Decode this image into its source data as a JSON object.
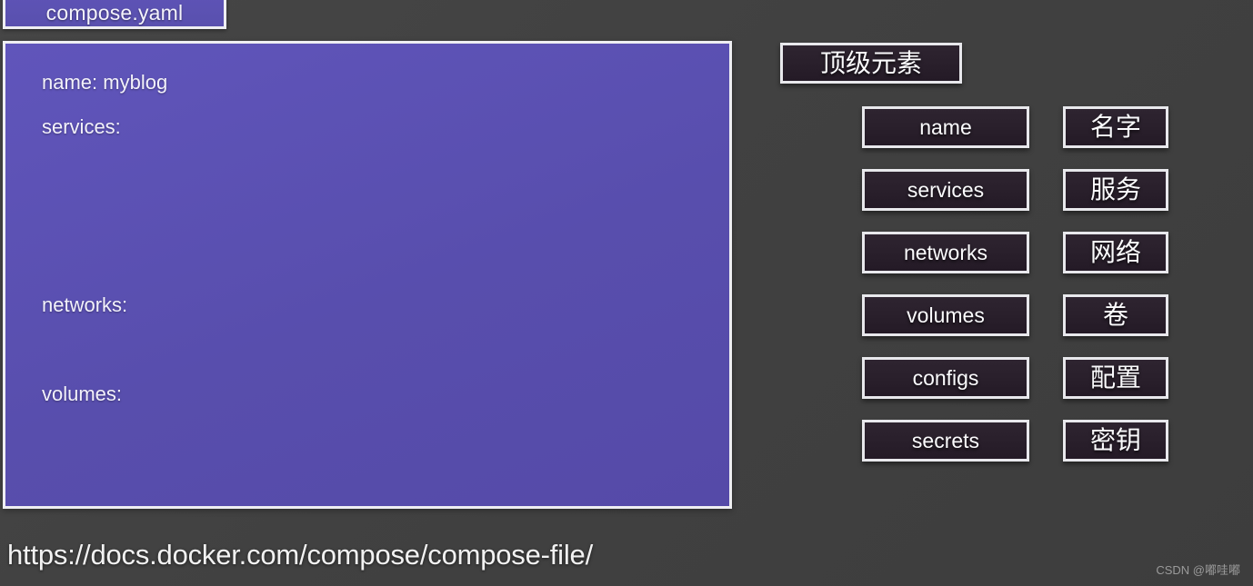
{
  "editor": {
    "tab_label": "compose.yaml",
    "code_lines": [
      "name: myblog",
      "services:",
      "",
      "",
      "",
      "networks:",
      "",
      "volumes:"
    ]
  },
  "doc_url": "https://docs.docker.com/compose/compose-file/",
  "diagram": {
    "header": "顶级元素",
    "rows": [
      {
        "key": "name",
        "cn": "名字"
      },
      {
        "key": "services",
        "cn": "服务"
      },
      {
        "key": "networks",
        "cn": "网络"
      },
      {
        "key": "volumes",
        "cn": "卷"
      },
      {
        "key": "configs",
        "cn": "配置"
      },
      {
        "key": "secrets",
        "cn": "密钥"
      }
    ]
  },
  "watermark": "CSDN @嘟哇嘟",
  "colors": {
    "background": "#434343",
    "panel_purple": "#584ead",
    "box_fill": "#2a202c",
    "box_border": "#e8e8ec",
    "text_light": "#f4f3fb"
  }
}
